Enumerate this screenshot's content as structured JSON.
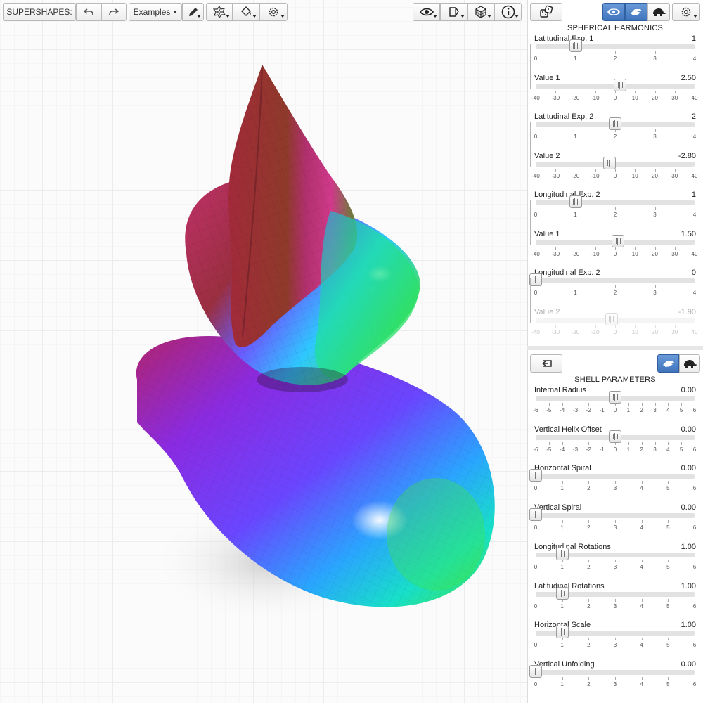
{
  "toolbar": {
    "app_label": "SUPERSHAPES:",
    "examples_label": "Examples",
    "icons": [
      "undo-icon",
      "redo-icon",
      "pencil-icon",
      "flower-icon",
      "paint-bucket-icon",
      "gear-icon",
      "eye-icon",
      "cube-outline-icon",
      "wireframe-cube-icon",
      "info-icon",
      "dice-icon",
      "rotate-icon",
      "hand-icon",
      "turtle-icon",
      "gear-icon"
    ]
  },
  "colors": {
    "accent": "#3f74bd",
    "track": "#e2e2e2",
    "separator": "#e6e6e6"
  },
  "harmonics": {
    "title": "SPHERICAL HARMONICS",
    "sliders": [
      {
        "label": "Latitudinal Exp. 1",
        "value": "1",
        "position": 1,
        "min": 0,
        "max": 4,
        "ticks": [
          "0",
          "1",
          "2",
          "3",
          "4"
        ],
        "disabled": false
      },
      {
        "label": "Value 1",
        "value": "2.50",
        "position": 2.5,
        "min": -40,
        "max": 40,
        "ticks": [
          "-40",
          "-30",
          "-20",
          "-10",
          "0",
          "10",
          "20",
          "30",
          "40"
        ],
        "disabled": false
      },
      {
        "label": "Latitudinal Exp. 2",
        "value": "2",
        "position": 2,
        "min": 0,
        "max": 4,
        "ticks": [
          "0",
          "1",
          "2",
          "3",
          "4"
        ],
        "disabled": false
      },
      {
        "label": "Value 2",
        "value": "-2.80",
        "position": -2.8,
        "min": -40,
        "max": 40,
        "ticks": [
          "-40",
          "-30",
          "-20",
          "-10",
          "0",
          "10",
          "20",
          "30",
          "40"
        ],
        "disabled": false
      },
      {
        "label": "Longitudinal Exp. 2",
        "value": "1",
        "position": 1,
        "min": 0,
        "max": 4,
        "ticks": [
          "0",
          "1",
          "2",
          "3",
          "4"
        ],
        "disabled": false
      },
      {
        "label": "Value 1",
        "value": "1.50",
        "position": 1.5,
        "min": -40,
        "max": 40,
        "ticks": [
          "-40",
          "-30",
          "-20",
          "-10",
          "0",
          "10",
          "20",
          "30",
          "40"
        ],
        "disabled": false
      },
      {
        "label": "Longitudinal Exp. 2",
        "value": "0",
        "position": 0,
        "min": 0,
        "max": 4,
        "ticks": [
          "0",
          "1",
          "2",
          "3",
          "4"
        ],
        "disabled": false
      },
      {
        "label": "Value 2",
        "value": "-1.90",
        "position": -1.9,
        "min": -40,
        "max": 40,
        "ticks": [
          "-40",
          "-30",
          "-20",
          "-10",
          "0",
          "10",
          "20",
          "30",
          "40"
        ],
        "disabled": true
      }
    ]
  },
  "shell": {
    "title": "SHELL PARAMETERS",
    "sliders": [
      {
        "label": "Internal Radius",
        "value": "0.00",
        "position": 0,
        "min": -6,
        "max": 6,
        "ticks": [
          "-6",
          "-5",
          "-4",
          "-3",
          "-2",
          "-1",
          "0",
          "1",
          "2",
          "3",
          "4",
          "5",
          "6"
        ],
        "disabled": false
      },
      {
        "label": "Vertical Helix Offset",
        "value": "0.00",
        "position": 0,
        "min": -6,
        "max": 6,
        "ticks": [
          "-6",
          "-5",
          "-4",
          "-3",
          "-2",
          "-1",
          "0",
          "1",
          "2",
          "3",
          "4",
          "5",
          "6"
        ],
        "disabled": false
      },
      {
        "label": "Horizontal Spiral",
        "value": "0.00",
        "position": 0,
        "min": 0,
        "max": 6,
        "ticks": [
          "0",
          "1",
          "2",
          "3",
          "4",
          "5",
          "6"
        ],
        "disabled": false
      },
      {
        "label": "Vertical Spiral",
        "value": "0.00",
        "position": 0,
        "min": 0,
        "max": 6,
        "ticks": [
          "0",
          "1",
          "2",
          "3",
          "4",
          "5",
          "6"
        ],
        "disabled": false
      },
      {
        "label": "Longitudinal Rotations",
        "value": "1.00",
        "position": 1,
        "min": 0,
        "max": 6,
        "ticks": [
          "0",
          "1",
          "2",
          "3",
          "4",
          "5",
          "6"
        ],
        "disabled": false
      },
      {
        "label": "Latitudinal Rotations",
        "value": "1.00",
        "position": 1,
        "min": 0,
        "max": 6,
        "ticks": [
          "0",
          "1",
          "2",
          "3",
          "4",
          "5",
          "6"
        ],
        "disabled": false
      },
      {
        "label": "Horizontal Scale",
        "value": "1.00",
        "position": 1,
        "min": 0,
        "max": 6,
        "ticks": [
          "0",
          "1",
          "2",
          "3",
          "4",
          "5",
          "6"
        ],
        "disabled": false
      },
      {
        "label": "Vertical Unfolding",
        "value": "0.00",
        "position": 0,
        "min": 0,
        "max": 6,
        "ticks": [
          "0",
          "1",
          "2",
          "3",
          "4",
          "5",
          "6"
        ],
        "disabled": false
      }
    ]
  }
}
